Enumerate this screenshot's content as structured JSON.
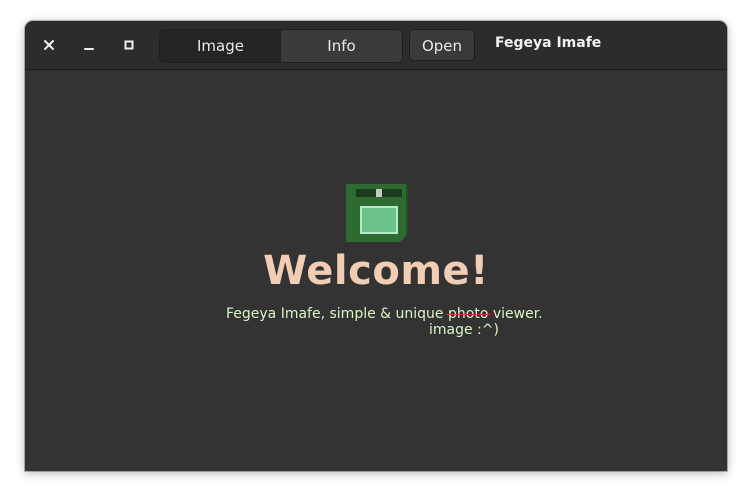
{
  "window": {
    "title": "Fegeya Imafe",
    "controls": {
      "close_icon": "close-icon",
      "minimize_icon": "minimize-icon",
      "maximize_icon": "maximize-icon"
    }
  },
  "header": {
    "tabs": [
      {
        "label": "Image",
        "active": true
      },
      {
        "label": "Info",
        "active": false
      }
    ],
    "open_label": "Open"
  },
  "main": {
    "logo_icon": "floppy-disk-icon",
    "welcome": "Welcome!",
    "tagline_prefix": "Fegeya Imafe, simple & unique ",
    "tagline_struck": "photo",
    "tagline_suffix": " viewer.",
    "tagline_correction": "image :^)"
  },
  "colors": {
    "background": "#333333",
    "titlebar": "#2c2c2c",
    "welcome_text": "#f0cdb4",
    "tagline_text": "#d8f5c4",
    "strike_line": "#c8333e",
    "logo_green": "#2e6b31",
    "logo_label": "#6cc38c"
  }
}
